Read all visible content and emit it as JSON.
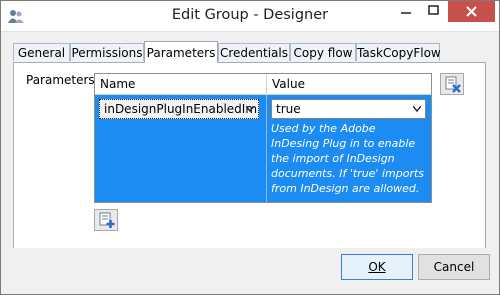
{
  "window": {
    "title": "Edit Group - Designer"
  },
  "tabs": [
    "General",
    "Permissions",
    "Parameters",
    "Credentials",
    "Copy flow",
    "TaskCopyFlow"
  ],
  "active_tab": "Parameters",
  "parameters": {
    "label": "Parameters:",
    "columns": {
      "name": "Name",
      "value": "Value"
    },
    "rows": [
      {
        "name": "inDesignPlugInEnabledIm",
        "value": "true",
        "description": "Used by the Adobe InDesing Plug in to enable the import of InDesign documents. If 'true' imports from InDesign are allowed."
      }
    ]
  },
  "buttons": {
    "ok": "OK",
    "cancel": "Cancel"
  },
  "colors": {
    "selection": "#1c8cf2",
    "close_button": "#c7504b"
  }
}
